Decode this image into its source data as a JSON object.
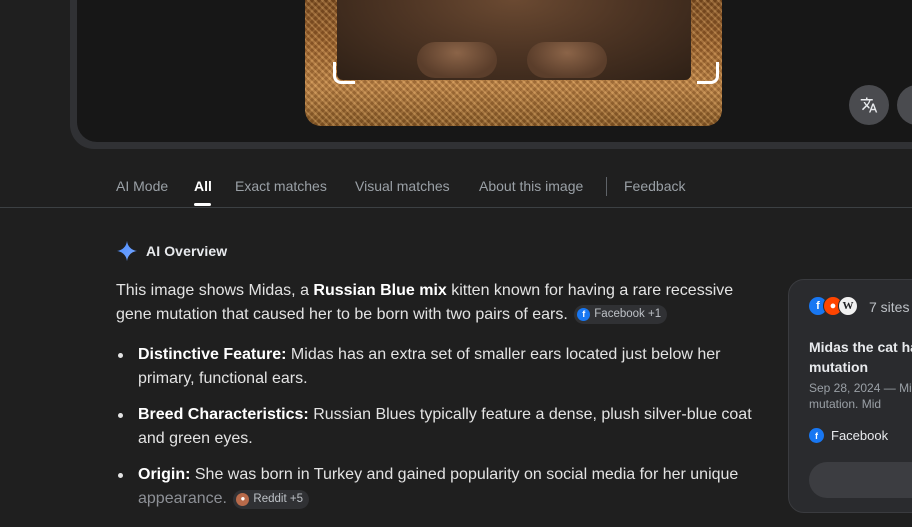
{
  "image_panel": {
    "translate_icon": "translate-icon",
    "partial_button_glyph": "ₗ"
  },
  "tabs": [
    {
      "label": "AI Mode"
    },
    {
      "label": "All"
    },
    {
      "label": "Exact matches"
    },
    {
      "label": "Visual matches"
    },
    {
      "label": "About this image"
    },
    {
      "label": "Feedback"
    }
  ],
  "ai_overview": {
    "heading": "AI Overview",
    "intro_before": "This image shows Midas, a ",
    "intro_bold": "Russian Blue mix",
    "intro_after": " kitten known for having a rare recessive gene mutation that caused her to be born with two pairs of ears.",
    "intro_chip": "Facebook +1",
    "bullets": [
      {
        "title": "Distinctive Feature:",
        "text": " Midas has an extra set of smaller ears located just below her primary, functional ears."
      },
      {
        "title": "Breed Characteristics:",
        "text": " Russian Blues typically feature a dense, plush silver-blue coat and green eyes."
      },
      {
        "title": "Origin:",
        "text": " She was born in Turkey and gained popularity on social media for her unique ",
        "faded": "appearance.",
        "chip": "Reddit +5"
      }
    ]
  },
  "source_card": {
    "count": "7 sites",
    "title": "Midas the cat ha mutation",
    "meta": "Sep 28, 2024 — Mi gene mutation. Mid",
    "site": "Facebook"
  },
  "colors": {
    "background": "#1f1f1f",
    "facebook": "#1877f2",
    "reddit": "#ff4500",
    "gemini_blue": "#4a8cff"
  }
}
